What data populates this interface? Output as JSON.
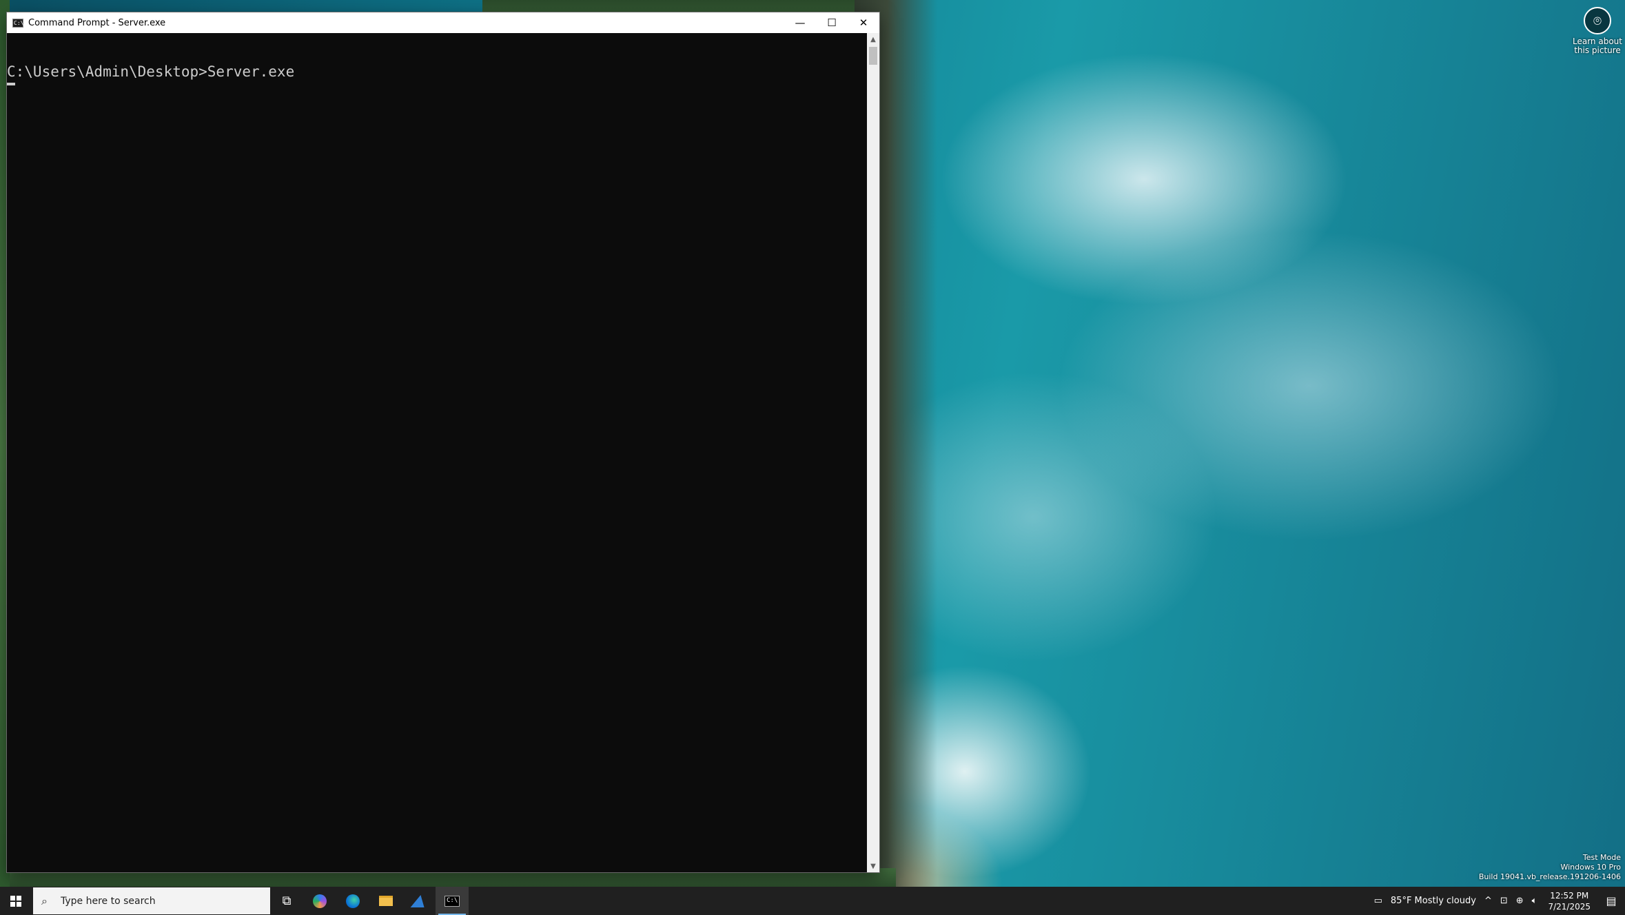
{
  "window": {
    "title": "Command Prompt - Server.exe",
    "icon_label": "C:\\",
    "buttons": {
      "minimize": "—",
      "maximize": "☐",
      "close": "✕"
    }
  },
  "console": {
    "line1": "C:\\Users\\Admin\\Desktop>Server.exe"
  },
  "scrollbar": {
    "up": "▲",
    "down": "▼"
  },
  "desktop": {
    "learn_line1": "Learn about",
    "learn_line2": "this picture",
    "watermark_line1": "Test Mode",
    "watermark_line2": "Windows 10 Pro",
    "watermark_line3": "Build 19041.vb_release.191206-1406"
  },
  "taskbar": {
    "search_placeholder": "Type here to search",
    "icons": [
      "windows-icon",
      "search-icon",
      "task-view-icon",
      "copilot-icon",
      "edge-icon",
      "file-explorer-icon",
      "blue-app-icon",
      "command-prompt-icon"
    ],
    "weather": "85°F  Mostly cloudy",
    "time": "12:52 PM",
    "date": "7/21/2025"
  },
  "colors": {
    "console_bg": "#0c0c0c",
    "console_text": "#cccccc",
    "taskbar_bg": "#202020",
    "accent": "#76b9ed"
  }
}
